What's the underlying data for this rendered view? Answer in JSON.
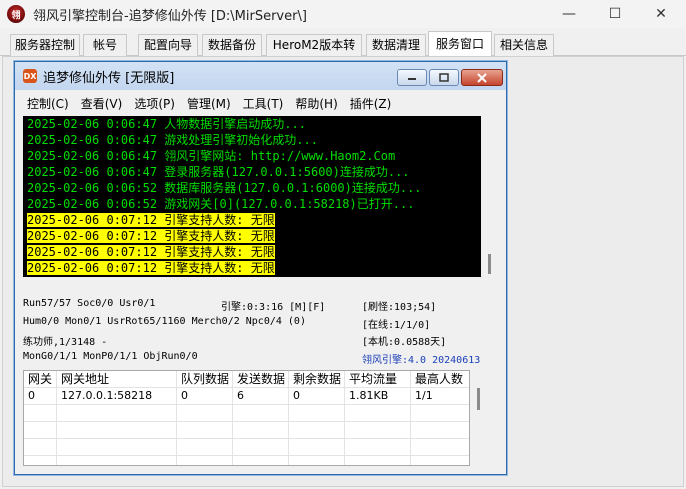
{
  "window": {
    "title": "翎风引擎控制台-追梦修仙外传 [D:\\MirServer\\]",
    "minimize_glyph": "—",
    "maximize_glyph": "☐",
    "close_glyph": "✕"
  },
  "tabs": [
    {
      "label": "服务器控制"
    },
    {
      "label": "帐号"
    },
    {
      "label": "配置向导"
    },
    {
      "label": "数据备份"
    },
    {
      "label": "HeroM2版本转换"
    },
    {
      "label": "数据清理"
    },
    {
      "label": "服务窗口",
      "active": true
    },
    {
      "label": "相关信息"
    }
  ],
  "inner": {
    "title": "追梦修仙外传 [无限版]",
    "icon_text": "DX",
    "menu": [
      {
        "label": "控制(C)"
      },
      {
        "label": "查看(V)"
      },
      {
        "label": "选项(P)"
      },
      {
        "label": "管理(M)"
      },
      {
        "label": "工具(T)"
      },
      {
        "label": "帮助(H)"
      },
      {
        "label": "插件(Z)"
      }
    ],
    "log": [
      {
        "text": "2025-02-06 0:06:47 人物数据引擎启动成功...",
        "style": "green"
      },
      {
        "text": "2025-02-06 0:06:47 游戏处理引擎初始化成功...",
        "style": "green"
      },
      {
        "text": "2025-02-06 0:06:47 翎风引擎网站: http://www.Haom2.Com",
        "style": "green"
      },
      {
        "text": "2025-02-06 0:06:47 登录服务器(127.0.0.1:5600)连接成功...",
        "style": "green"
      },
      {
        "text": "2025-02-06 0:06:52 数据库服务器(127.0.0.1:6000)连接成功...",
        "style": "green"
      },
      {
        "text": "2025-02-06 0:06:52 游戏网关[0](127.0.0.1:58218)已打开...",
        "style": "green"
      },
      {
        "text": "2025-02-06 0:07:12 引擎支持人数: 无限",
        "style": "highlight"
      },
      {
        "text": "2025-02-06 0:07:12 引擎支持人数: 无限",
        "style": "highlight"
      },
      {
        "text": "2025-02-06 0:07:12 引擎支持人数: 无限",
        "style": "highlight"
      },
      {
        "text": "2025-02-06 0:07:12 引擎支持人数: 无限",
        "style": "highlight"
      }
    ],
    "status": {
      "run": "Run57/57 Soc0/0 Usr0/1",
      "engine_time": "引擎:0:3:16 [M][F]",
      "refresh_monsters": "[刷怪:103;54]",
      "hum": "Hum0/0 Mon0/1 UsrRot65/1160 Merch0/2 Npc0/4 (0)",
      "online": "[在线:1/1/0]",
      "practice": "练功师,1/3148 -",
      "local": "[本机:0.0588天]",
      "mongo": "MonG0/1/1 MonP0/1/1 ObjRun0/0",
      "engine_version": "翎风引擎:4.0 20240613"
    },
    "gateway_table": {
      "columns": [
        "网关",
        "网关地址",
        "队列数据",
        "发送数据",
        "剩余数据",
        "平均流量",
        "最高人数"
      ],
      "rows": [
        [
          "0",
          "127.0.0.1:58218",
          "0",
          "6",
          "0",
          "1.81KB",
          "1/1"
        ]
      ],
      "empty_rows": 4
    }
  }
}
